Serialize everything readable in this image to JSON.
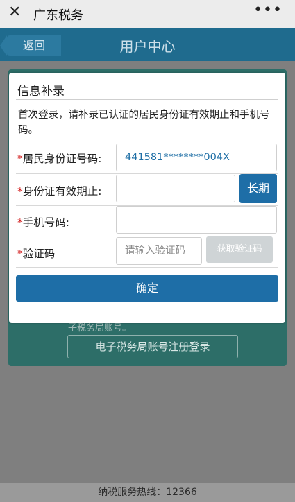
{
  "wechat_bar": {
    "close_glyph": "✕",
    "title": "广东税务",
    "more_glyph": "•••"
  },
  "header": {
    "back_label": "返回",
    "title": "用户中心"
  },
  "background": {
    "hint": "子税务局账号。",
    "register_button": "电子税务局账号注册登录"
  },
  "dialog": {
    "title": "信息补录",
    "description": "首次登录，请补录已认证的居民身份证有效期止和手机号码。",
    "fields": {
      "id_number": {
        "required_mark": "*",
        "label": "居民身份证号码:",
        "value": "441581********004X"
      },
      "id_expiry": {
        "required_mark": "*",
        "label": "身份证有效期止:",
        "value": "",
        "long_term_button": "长期"
      },
      "phone": {
        "required_mark": "*",
        "label": "手机号码:",
        "value": ""
      },
      "code": {
        "required_mark": "*",
        "label": "验证码",
        "placeholder": "请输入验证码",
        "get_code_button": "获取验证码"
      }
    },
    "confirm_button": "确定"
  },
  "footer": {
    "hotline": "纳税服务热线：12366"
  },
  "colors": {
    "primary": "#1e6ea7",
    "required": "#d21a1a",
    "disabled_button": "#cfd4d6",
    "overlay": "#7f7f7f"
  }
}
